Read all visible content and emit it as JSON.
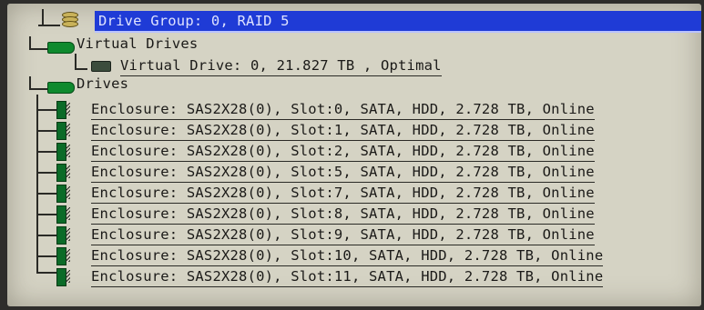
{
  "tree": {
    "drive_group": {
      "label": "Drive Group: 0, RAID 5",
      "icon": "database-icon"
    },
    "virtual_drives_folder": {
      "label": "Virtual Drives",
      "icon": "folder-icon"
    },
    "virtual_drive": {
      "label": "Virtual Drive: 0, 21.827 TB , Optimal",
      "icon": "virtual-drive-icon"
    },
    "drives_folder": {
      "label": "Drives",
      "icon": "folder-icon"
    },
    "drives": [
      {
        "label": "Enclosure: SAS2X28(0), Slot:0, SATA, HDD, 2.728 TB, Online"
      },
      {
        "label": "Enclosure: SAS2X28(0), Slot:1, SATA, HDD, 2.728 TB, Online"
      },
      {
        "label": "Enclosure: SAS2X28(0), Slot:2, SATA, HDD, 2.728 TB, Online"
      },
      {
        "label": "Enclosure: SAS2X28(0), Slot:5, SATA, HDD, 2.728 TB, Online"
      },
      {
        "label": "Enclosure: SAS2X28(0), Slot:7, SATA, HDD, 2.728 TB, Online"
      },
      {
        "label": "Enclosure: SAS2X28(0), Slot:8, SATA, HDD, 2.728 TB, Online"
      },
      {
        "label": "Enclosure: SAS2X28(0), Slot:9, SATA, HDD, 2.728 TB, Online"
      },
      {
        "label": "Enclosure: SAS2X28(0), Slot:10, SATA, HDD, 2.728 TB, Online"
      },
      {
        "label": "Enclosure: SAS2X28(0), Slot:11, SATA, HDD, 2.728 TB, Online"
      }
    ]
  },
  "colors": {
    "selection": "#1f3bd6",
    "panel": "#d5d3c4",
    "folder_green": "#0f8a2e"
  }
}
